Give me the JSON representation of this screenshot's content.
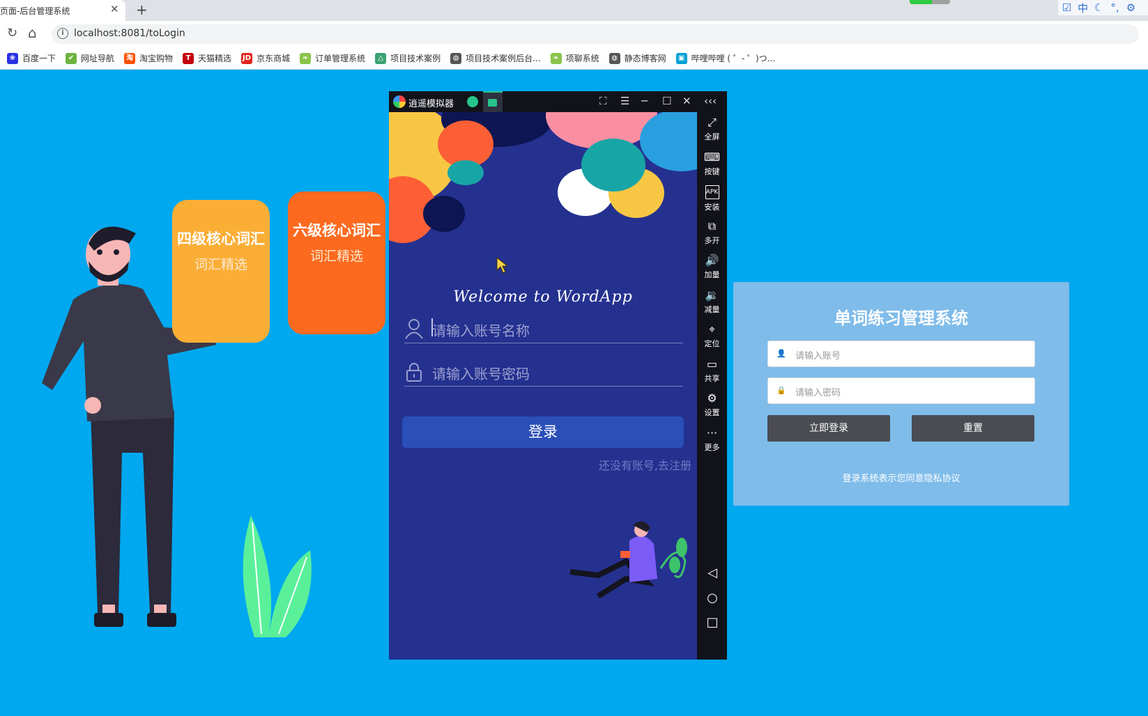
{
  "browser": {
    "tab_title": "页面-后台管理系统",
    "tab_close": "✕",
    "new_tab": "+",
    "url": "localhost:8081/toLogin",
    "extension_progress": 0.55,
    "tray_icons": [
      "checkbox-icon",
      "ime-chinese-icon",
      "moon-icon",
      "punctuation-icon",
      "gear-icon"
    ],
    "tray_labels": [
      "☑",
      "中",
      "☾",
      "°,",
      "⚙"
    ],
    "bookmarks": [
      {
        "label": "百度一下",
        "icon": "baidu-icon",
        "color": "#2932e1",
        "glyph": "❀"
      },
      {
        "label": "网址导航",
        "icon": "hao-icon",
        "color": "#6cb33f",
        "glyph": "✔"
      },
      {
        "label": "淘宝购物",
        "icon": "taobao-icon",
        "color": "#ff5000",
        "glyph": "淘"
      },
      {
        "label": "天猫精选",
        "icon": "tmall-icon",
        "color": "#c4000c",
        "glyph": "T"
      },
      {
        "label": "京东商城",
        "icon": "jd-icon",
        "color": "#e1251b",
        "glyph": "JD"
      },
      {
        "label": "订单管理系统",
        "icon": "leaf-icon",
        "color": "#8bc34a",
        "glyph": "❧"
      },
      {
        "label": "项目技术案例",
        "icon": "triangle-icon",
        "color": "#3ba272",
        "glyph": "△"
      },
      {
        "label": "项目技术案例后台...",
        "icon": "globe-icon",
        "color": "#555555",
        "glyph": "◍"
      },
      {
        "label": "项聊系统",
        "icon": "leaf-icon",
        "color": "#8bc34a",
        "glyph": "❧"
      },
      {
        "label": "静态博客网",
        "icon": "globe-icon",
        "color": "#555555",
        "glyph": "◍"
      },
      {
        "label": "哔哩哔哩 ( ゜- ゜)つ...",
        "icon": "bilibili-icon",
        "color": "#00a1d6",
        "glyph": "▣"
      }
    ]
  },
  "cards": {
    "cet4": {
      "title": "四级核心词汇",
      "subtitle": "词汇精选"
    },
    "cet6": {
      "title": "六级核心词汇",
      "subtitle": "词汇精选"
    }
  },
  "emulator": {
    "title": "逍遥模拟器",
    "controls": {
      "fullscreen": "⛶",
      "menu": "☰",
      "minimize": "─",
      "maximize": "☐",
      "close": "✕",
      "collapse": "‹‹‹"
    },
    "sidebar": [
      {
        "label": "全屏",
        "glyph": "⤢",
        "icon": "fullscreen-icon"
      },
      {
        "label": "按键",
        "glyph": "⌨",
        "icon": "keyboard-icon"
      },
      {
        "label": "安装",
        "glyph": "APK",
        "icon": "apk-icon"
      },
      {
        "label": "多开",
        "glyph": "⧉",
        "icon": "multi-instance-icon"
      },
      {
        "label": "加量",
        "glyph": "🔊",
        "icon": "volume-up-icon"
      },
      {
        "label": "减量",
        "glyph": "🔉",
        "icon": "volume-down-icon"
      },
      {
        "label": "定位",
        "glyph": "⌖",
        "icon": "location-icon"
      },
      {
        "label": "共享",
        "glyph": "▭",
        "icon": "folder-icon"
      },
      {
        "label": "设置",
        "glyph": "⚙",
        "icon": "gear-icon"
      },
      {
        "label": "更多",
        "glyph": "···",
        "icon": "more-icon"
      }
    ],
    "nav": {
      "back": "◁",
      "home": "○",
      "recents": "□"
    },
    "app": {
      "welcome": "Welcome  to  WordApp",
      "username_placeholder": "请输入账号名称",
      "password_placeholder": "请输入账号密码",
      "login_button": "登录",
      "register_link": "还没有账号,去注册"
    }
  },
  "login_panel": {
    "title": "单词练习管理系统",
    "username_placeholder": "请输入账号",
    "password_placeholder": "请输入密码",
    "login_button": "立即登录",
    "reset_button": "重置",
    "agreement": "登录系统表示您同意隐私协议"
  },
  "colors": {
    "page_background": "#00a8ef",
    "app_background": "#25318f",
    "app_button": "#2a4fb8",
    "card_cet4": "#fbae36",
    "card_cet6": "#fc6a1f",
    "panel_button": "#4a4c52"
  }
}
